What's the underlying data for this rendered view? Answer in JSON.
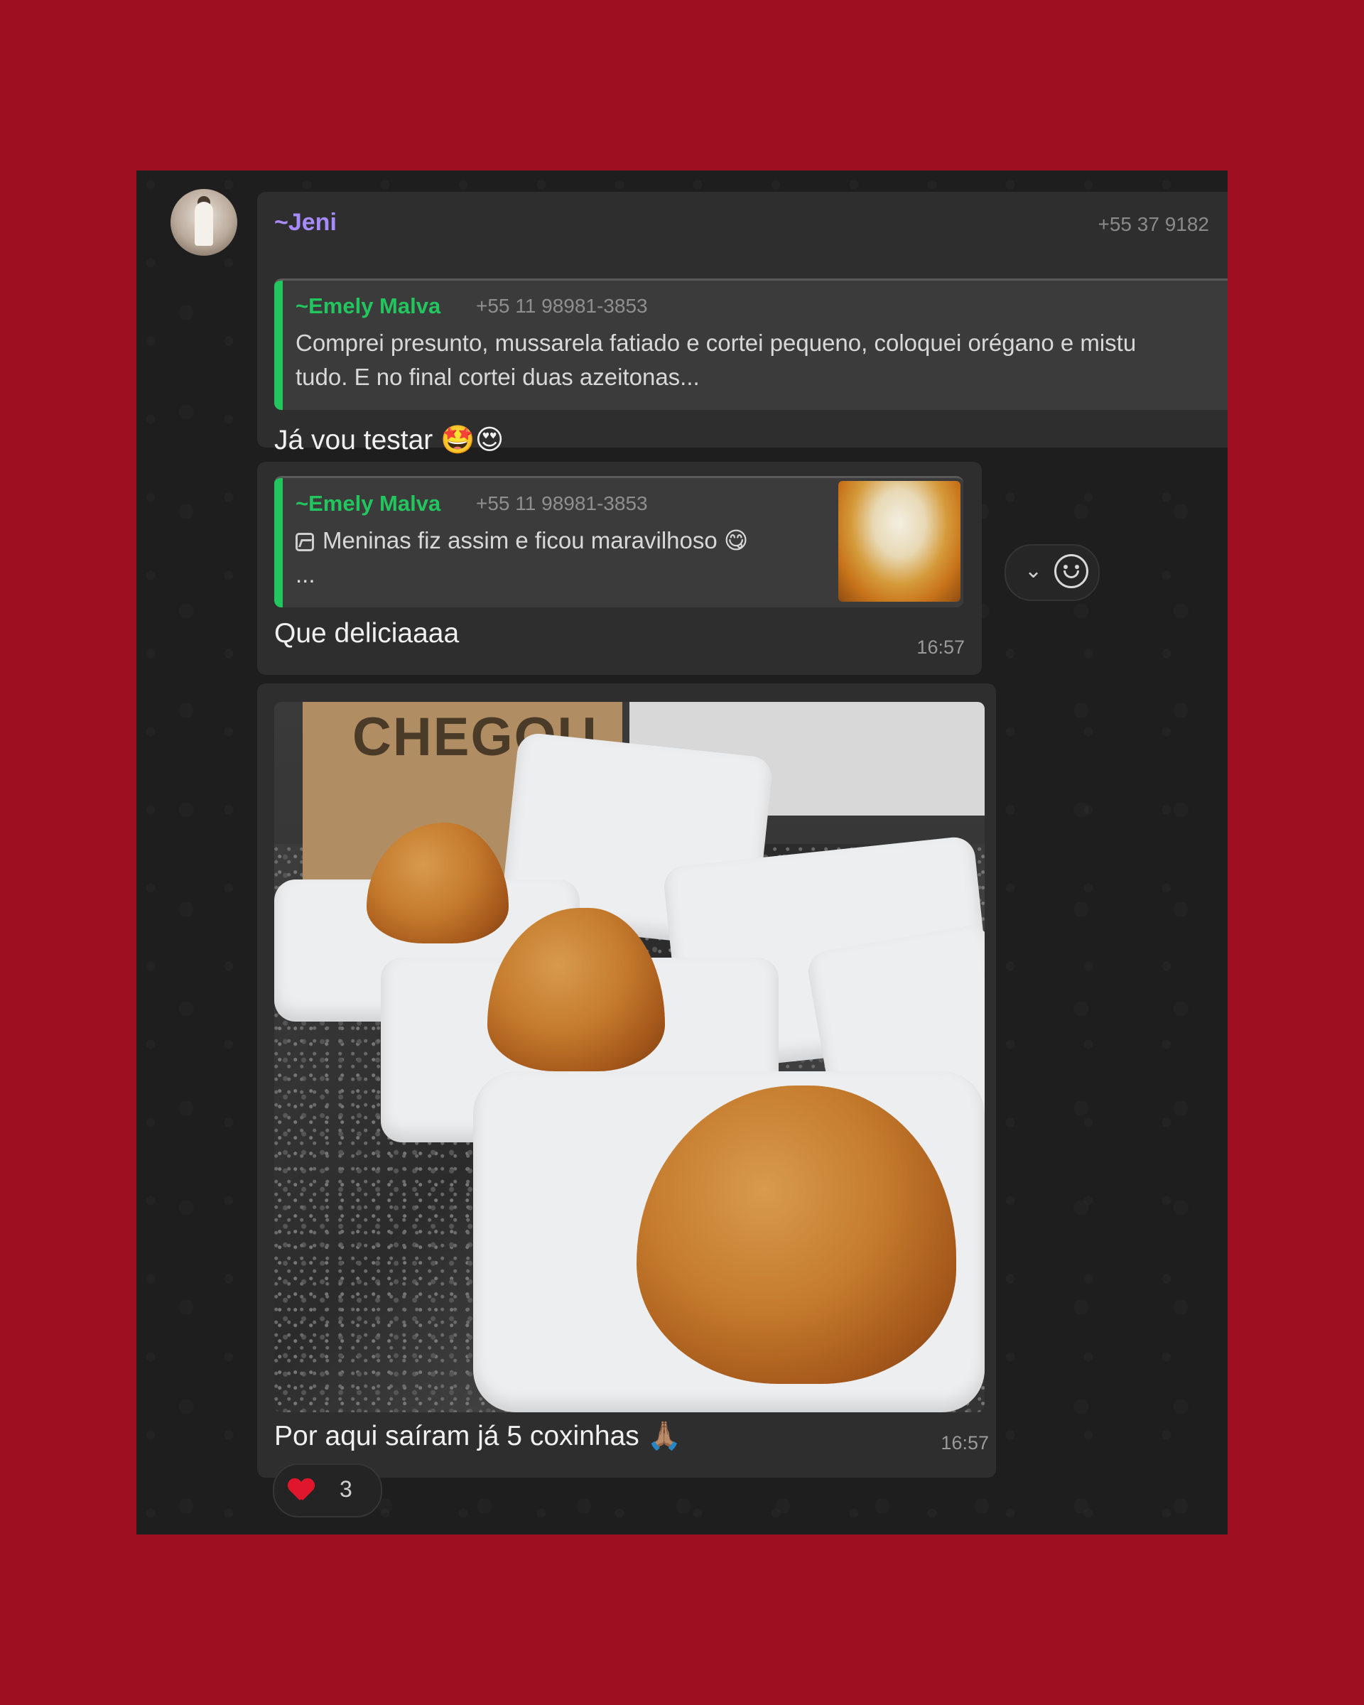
{
  "messages": [
    {
      "sender": "~Jeni",
      "sender_phone": "+55 37 9182",
      "quote": {
        "author": "~Emely Malva",
        "phone": "+55 11 98981-3853",
        "line1": "Comprei presunto, mussarela fatiado e cortei pequeno, coloquei orégano e mistu",
        "line2": "tudo. E no final cortei duas azeitonas..."
      },
      "text": "Já vou testar 🤩😍"
    },
    {
      "quote": {
        "author": "~Emely Malva",
        "phone": "+55 11 98981-3853",
        "line1": "Meninas fiz assim e ficou maravilhoso 😋",
        "line2": "...",
        "thumbnail_icon": "photo-icon"
      },
      "text": "Que deliciaaaa",
      "time": "16:57"
    },
    {
      "image": {
        "bag_text": "CHEGOU."
      },
      "text": "Por aqui saíram já 5 coxinhas 🙏🏽",
      "time": "16:57",
      "reaction": {
        "emoji": "heart",
        "count": "3"
      }
    }
  ],
  "hover_actions": {
    "menu_icon": "chevron-down-icon",
    "react_icon": "smiley-icon"
  },
  "colors": {
    "frame": "#9e0f22",
    "chat_bg": "#1e1e1e",
    "bubble": "#2e2e2e",
    "sender": "#a78bfa",
    "quote_accent": "#22c55e"
  }
}
